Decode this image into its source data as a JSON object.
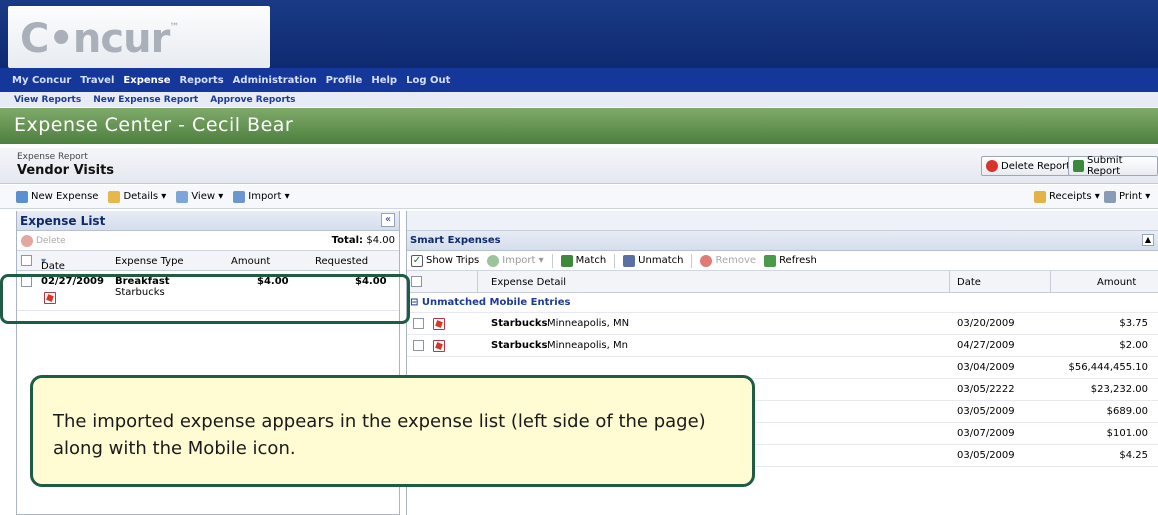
{
  "app": {
    "logo": "C•ncur",
    "logo_tm": "™"
  },
  "nav": [
    "My Concur",
    "Travel",
    "Expense",
    "Reports",
    "Administration",
    "Profile",
    "Help",
    "Log Out"
  ],
  "subnav": [
    "View Reports",
    "New Expense Report",
    "Approve Reports"
  ],
  "banner": {
    "title": "Expense Center - Cecil Bear"
  },
  "report": {
    "label": "Expense Report",
    "name": "Vendor Visits"
  },
  "actions": {
    "delete_report": "Delete Report",
    "submit_report": "Submit Report"
  },
  "toolbar": {
    "new_expense": "New Expense",
    "details": "Details",
    "view": "View",
    "import": "Import",
    "receipts": "Receipts",
    "print": "Print"
  },
  "expense_list": {
    "title": "Expense List",
    "delete": "Delete",
    "total_label": "Total:",
    "total_value": "$4.00",
    "columns": [
      "Date",
      "Expense Type",
      "Amount",
      "Requested"
    ],
    "rows": [
      {
        "date": "02/27/2009",
        "type": "Breakfast",
        "vendor": "Starbucks",
        "amount": "$4.00",
        "requested": "$4.00"
      }
    ]
  },
  "smart": {
    "title": "Smart Expenses",
    "show_trips": "Show Trips",
    "import": "Import",
    "match": "Match",
    "unmatch": "Unmatch",
    "remove": "Remove",
    "refresh": "Refresh",
    "columns": [
      "Expense Detail",
      "Date",
      "Amount"
    ],
    "group_label": "Unmatched Mobile Entries",
    "rows": [
      {
        "vendor": "Starbucks",
        "location": "Minneapolis, MN",
        "date": "03/20/2009",
        "amount": "$3.75"
      },
      {
        "vendor": "Starbucks",
        "location": "Minneapolis, Mn",
        "date": "04/27/2009",
        "amount": "$2.00"
      },
      {
        "vendor": "",
        "location": "",
        "date": "03/04/2009",
        "amount": "$56,444,455.10"
      },
      {
        "vendor": "",
        "location": "",
        "date": "03/05/2222",
        "amount": "$23,232.00"
      },
      {
        "vendor": "",
        "location": "",
        "date": "03/05/2009",
        "amount": "$689.00"
      },
      {
        "vendor": "",
        "location": "",
        "date": "03/07/2009",
        "amount": "$101.00"
      },
      {
        "vendor": "",
        "location": "",
        "date": "03/05/2009",
        "amount": "$4.25"
      }
    ]
  },
  "callout": "The imported expense appears in the expense list (left side of the page) along with the Mobile icon."
}
